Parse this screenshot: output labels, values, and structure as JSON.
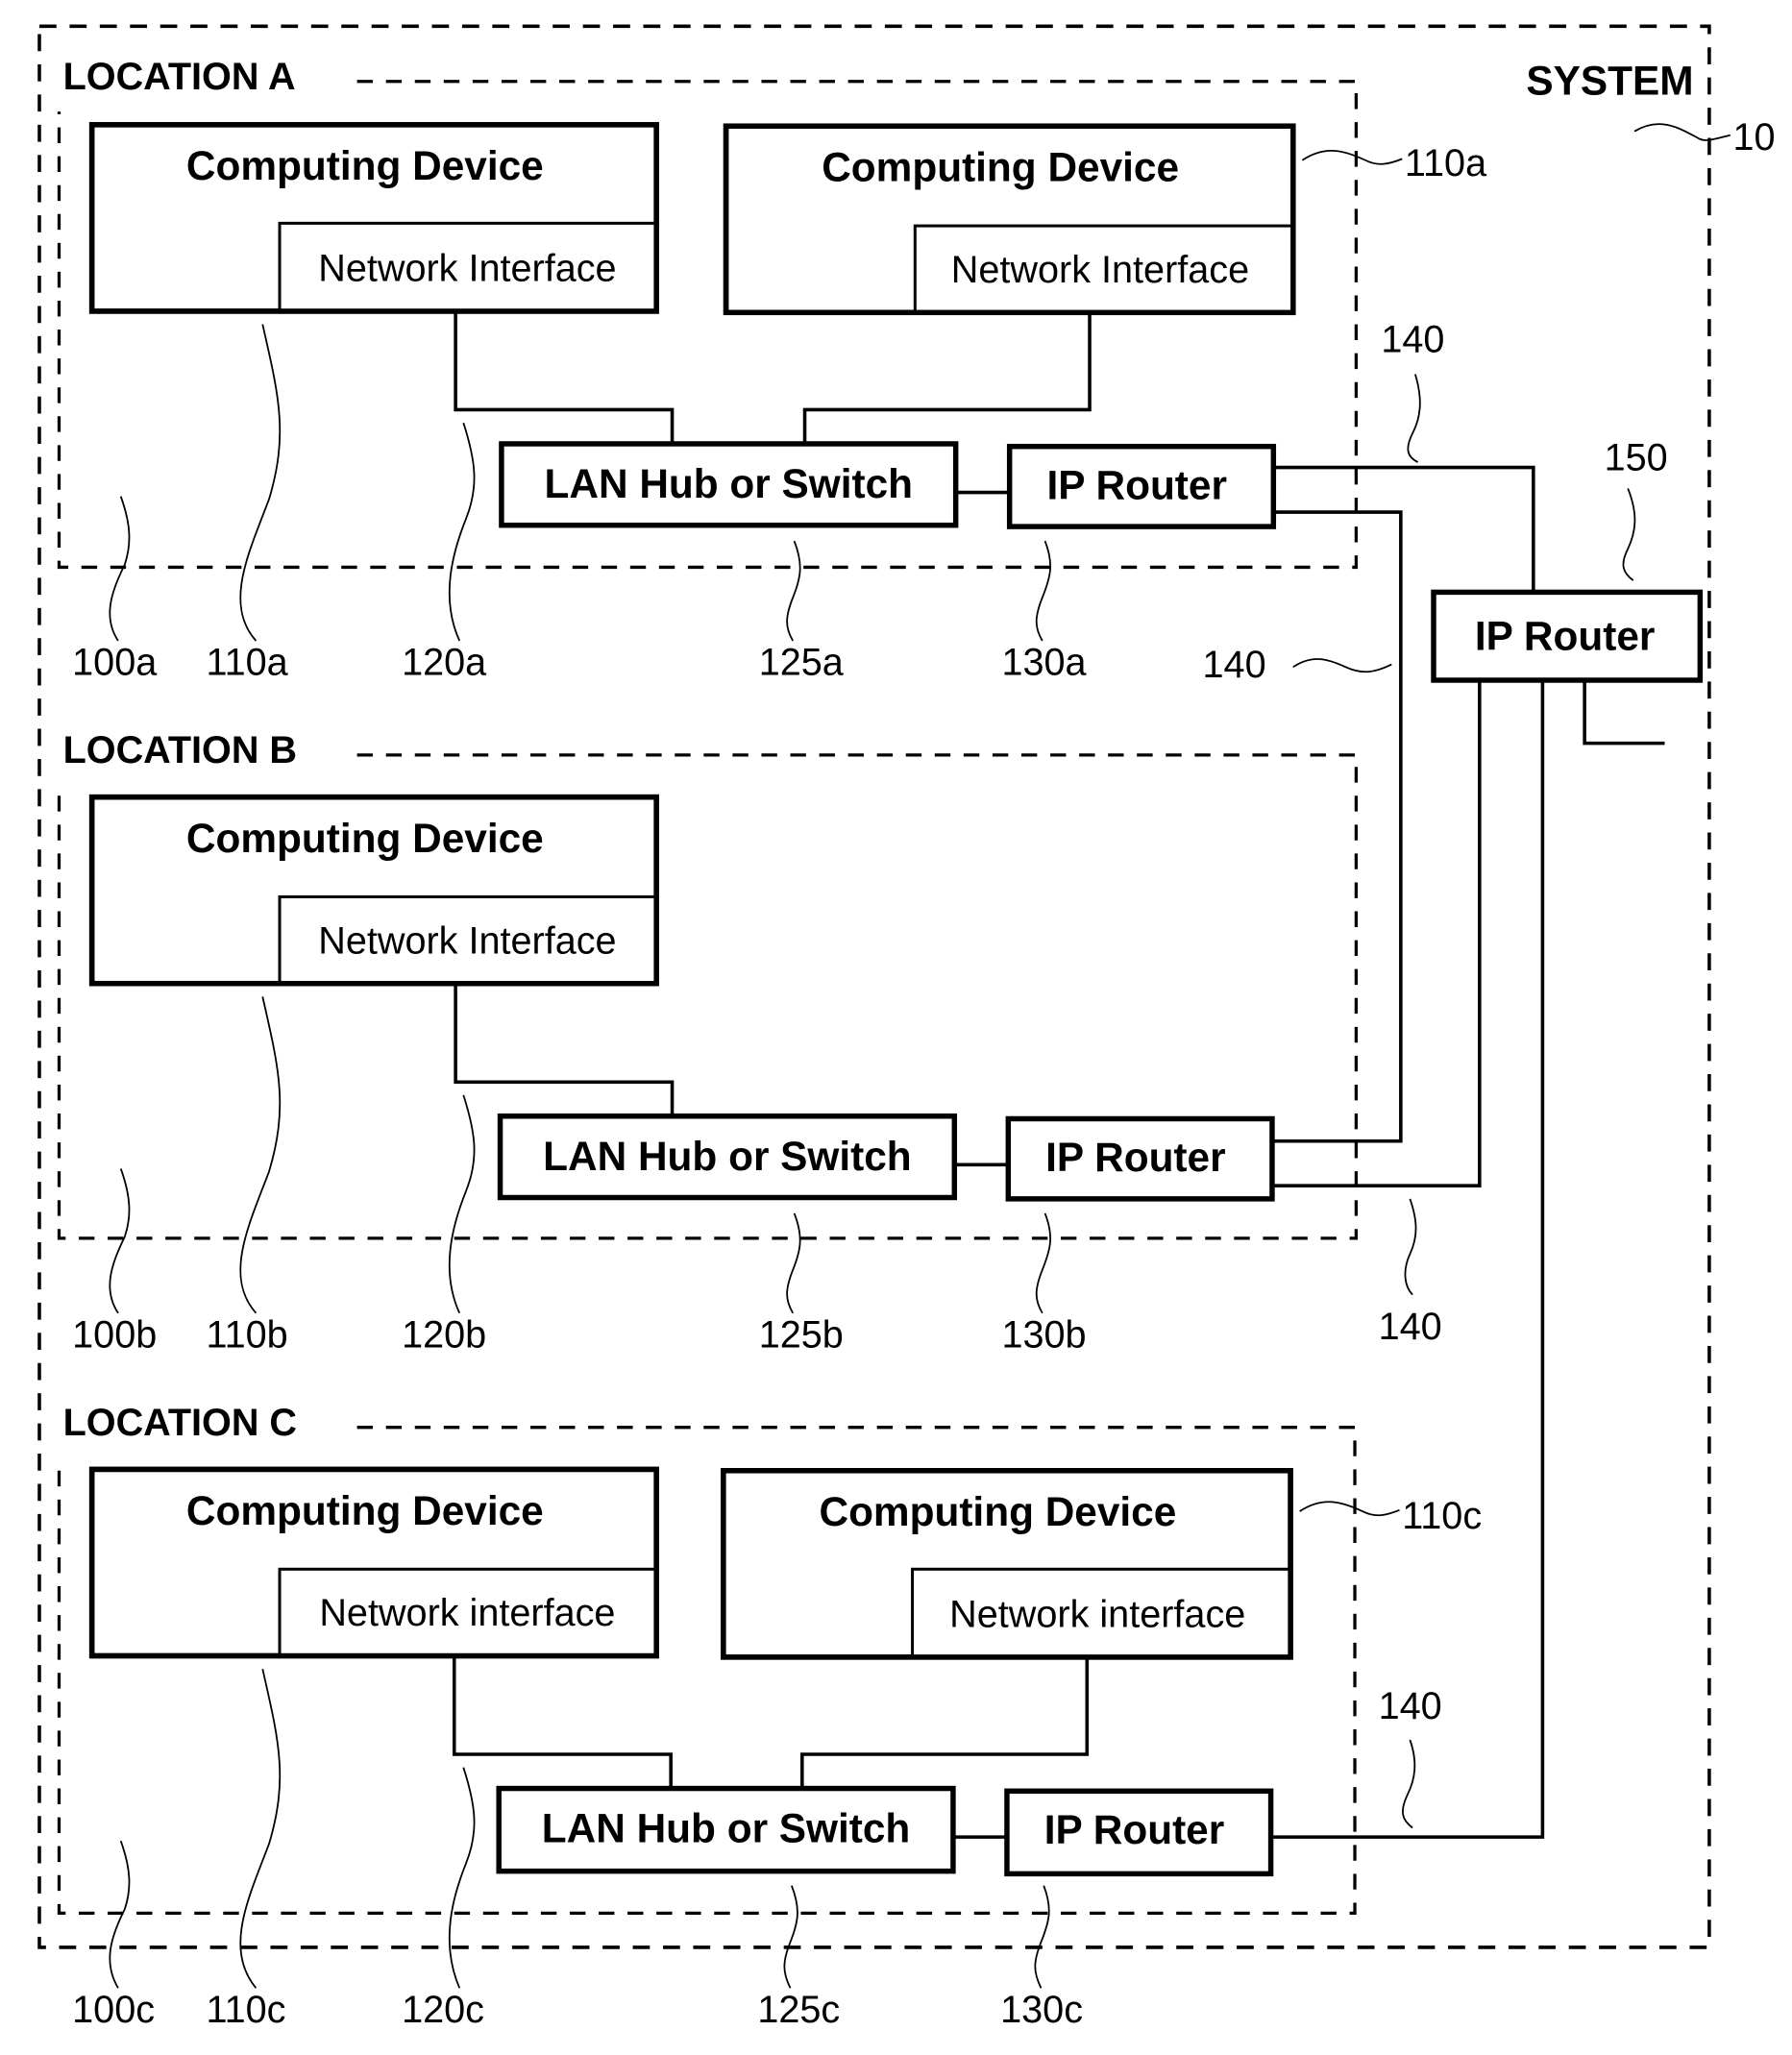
{
  "system": {
    "label": "SYSTEM",
    "ref": "10"
  },
  "locations": [
    {
      "label": "LOCATION A",
      "devices": [
        {
          "title": "Computing Device",
          "interface": "Network Interface"
        },
        {
          "title": "Computing Device",
          "interface": "Network Interface"
        }
      ],
      "hub": "LAN Hub or Switch",
      "router": "IP Router",
      "refs": {
        "location": "100a",
        "device": "110a",
        "interface": "120a",
        "hub": "125a",
        "router": "130a",
        "device_right": "110a"
      }
    },
    {
      "label": "LOCATION B",
      "devices": [
        {
          "title": "Computing Device",
          "interface": "Network Interface"
        }
      ],
      "hub": "LAN Hub or Switch",
      "router": "IP Router",
      "refs": {
        "location": "100b",
        "device": "110b",
        "interface": "120b",
        "hub": "125b",
        "router": "130b"
      }
    },
    {
      "label": "LOCATION C",
      "devices": [
        {
          "title": "Computing Device",
          "interface": "Network interface"
        },
        {
          "title": "Computing Device",
          "interface": "Network interface"
        }
      ],
      "hub": "LAN Hub or Switch",
      "router": "IP Router",
      "refs": {
        "location": "100c",
        "device": "110c",
        "interface": "120c",
        "hub": "125c",
        "router": "130c",
        "device_right": "110c"
      }
    }
  ],
  "central_router": {
    "label": "IP Router",
    "ref": "150"
  },
  "links": {
    "ref_top": "140",
    "ref_mid": "140",
    "ref_b": "140",
    "ref_c": "140"
  }
}
